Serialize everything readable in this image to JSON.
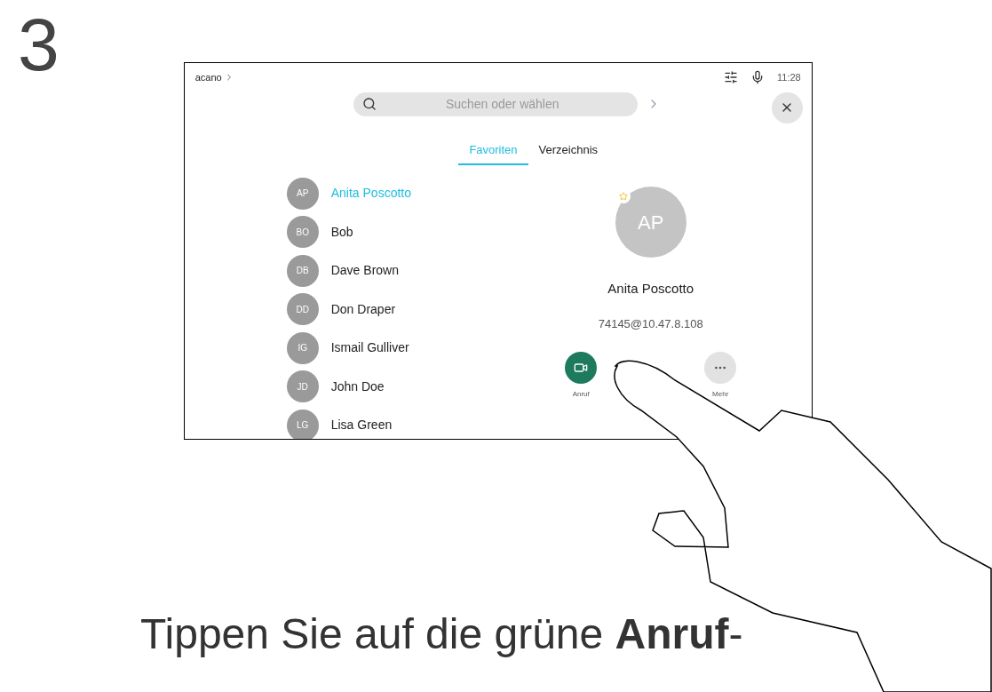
{
  "step": "3",
  "screen": {
    "breadcrumb": "acano",
    "time": "11:28",
    "search": {
      "placeholder": "Suchen oder wählen"
    },
    "tabs": [
      {
        "label": "Favoriten",
        "selected": true
      },
      {
        "label": "Verzeichnis",
        "selected": false
      }
    ],
    "contacts": [
      {
        "initials": "AP",
        "name": "Anita Poscotto",
        "selected": true
      },
      {
        "initials": "BO",
        "name": "Bob",
        "selected": false
      },
      {
        "initials": "DB",
        "name": "Dave Brown",
        "selected": false
      },
      {
        "initials": "DD",
        "name": "Don Draper",
        "selected": false
      },
      {
        "initials": "IG",
        "name": "Ismail Gulliver",
        "selected": false
      },
      {
        "initials": "JD",
        "name": "John Doe",
        "selected": false
      },
      {
        "initials": "LG",
        "name": "Lisa Green",
        "selected": false
      }
    ],
    "detail": {
      "initials": "AP",
      "favorite": true,
      "name": "Anita Poscotto",
      "address": "74145@10.47.8.108",
      "actions": [
        {
          "kind": "call",
          "label": "Anruf"
        },
        {
          "kind": "more",
          "label": "Mehr"
        }
      ]
    }
  },
  "caption": "Tippen Sie auf die grüne **Anruf**-"
}
